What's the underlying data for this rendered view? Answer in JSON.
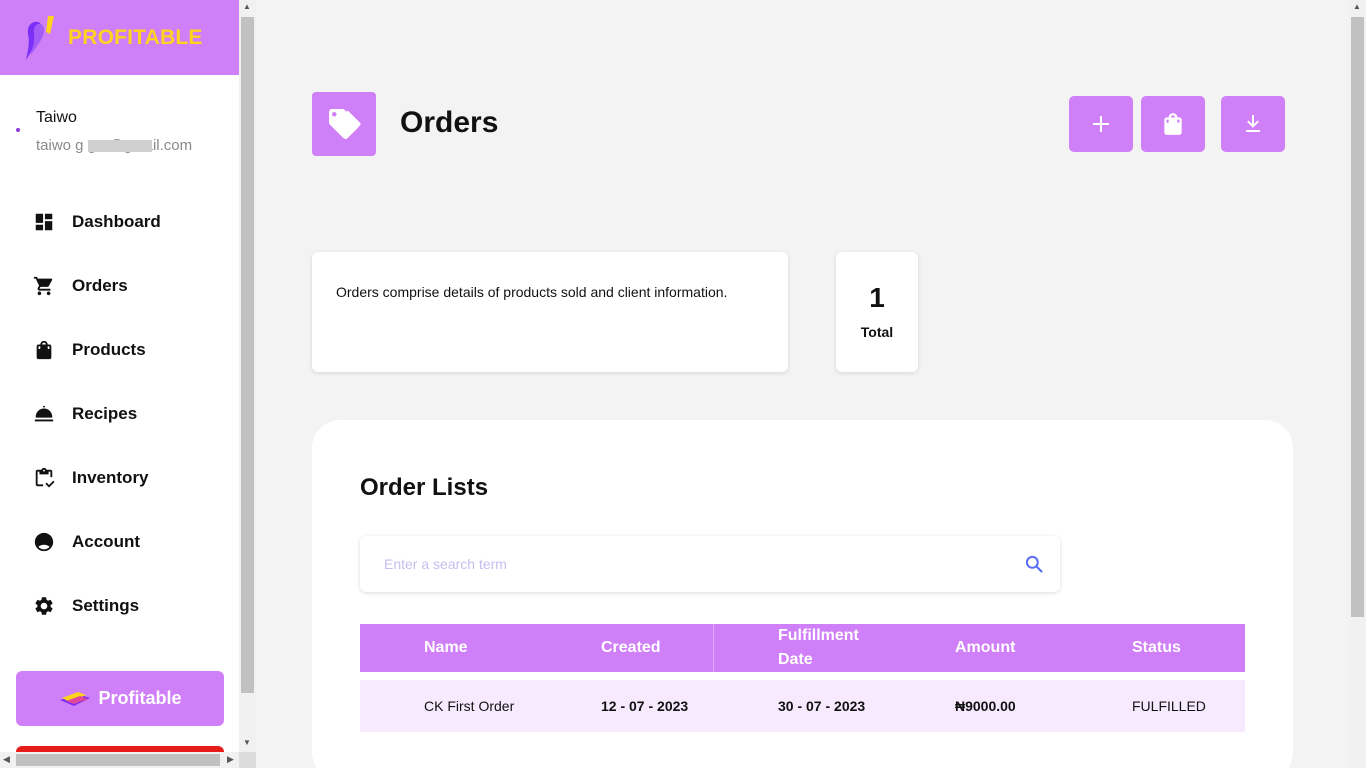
{
  "brand": {
    "name": "PROFITABLE"
  },
  "user": {
    "name": "Taiwo",
    "email": "taiwo          g  g  1@gmail.com"
  },
  "sidebar": {
    "items": [
      {
        "label": "Dashboard",
        "icon": "dashboard-icon"
      },
      {
        "label": "Orders",
        "icon": "cart-icon"
      },
      {
        "label": "Products",
        "icon": "bag-icon"
      },
      {
        "label": "Recipes",
        "icon": "cloche-icon"
      },
      {
        "label": "Inventory",
        "icon": "clipboard-icon"
      },
      {
        "label": "Account",
        "icon": "account-icon"
      },
      {
        "label": "Settings",
        "icon": "gear-icon"
      }
    ],
    "promo_label": "Profitable"
  },
  "header": {
    "title": "Orders",
    "icon": "tag-icon",
    "actions": [
      "plus-icon",
      "shopping-bag-icon",
      "download-icon"
    ]
  },
  "description": "Orders comprise details of products sold and client information.",
  "stats": {
    "total_value": "1",
    "total_label": "Total"
  },
  "order_list": {
    "title": "Order Lists",
    "search_placeholder": "Enter a search term",
    "columns": [
      "Name",
      "Created",
      "Fulfillment Date",
      "Amount",
      "Status"
    ],
    "rows": [
      {
        "name": "CK First Order",
        "created": "12 - 07 - 2023",
        "fulfillment": "30 - 07 - 2023",
        "amount": "₦9000.00",
        "status": "FULFILLED"
      }
    ]
  },
  "colors": {
    "accent": "#cf7ff7",
    "brand_text": "#ffd21f",
    "row_bg": "#f7eafe",
    "danger": "#e81b1b"
  }
}
